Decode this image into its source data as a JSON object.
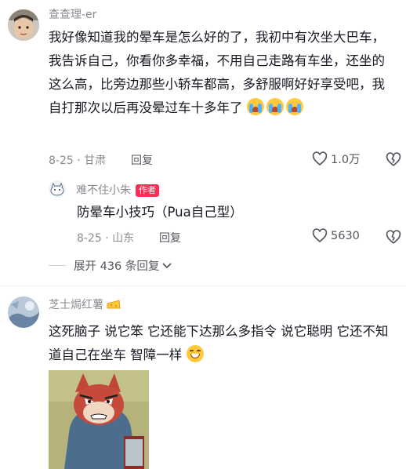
{
  "comments": [
    {
      "username": "查查理-er",
      "text": "我好像知道我的晕车是怎么好的了，我初中有次坐大巴车，我告诉自己，你看你多幸福，不用自己走路有车坐，还坐的这么高，比旁边那些小轿车都高，多舒服啊好好享受吧，我自打那次以后再没晕过车十多年了",
      "emojis": [
        "crying-laughing",
        "crying-laughing",
        "crying-laughing"
      ],
      "date": "8-25",
      "location": "甘肃",
      "reply_label": "回复",
      "likes": "1.0万",
      "reply": {
        "username": "难不住小朱",
        "badge": "作者",
        "text": "防晕车小技巧（Pua自己型）",
        "date": "8-25",
        "location": "山东",
        "reply_label": "回复",
        "likes": "5630"
      },
      "expand_label": "展开 436 条回复"
    },
    {
      "username": "芝士焗红薯",
      "username_emoji": "cheese",
      "text": "这死脑子 说它笨 它还能下达那么多指令 说它聪明 它还不知道自己在坐车 智障一样",
      "emojis": [
        "grinning-sweat"
      ]
    }
  ],
  "colors": {
    "accent": "#fe2c55",
    "text": "#161823",
    "muted": "#8a8b91"
  },
  "icons": [
    "heart-icon",
    "broken-heart-icon",
    "chevron-down-icon",
    "cheese-icon"
  ]
}
